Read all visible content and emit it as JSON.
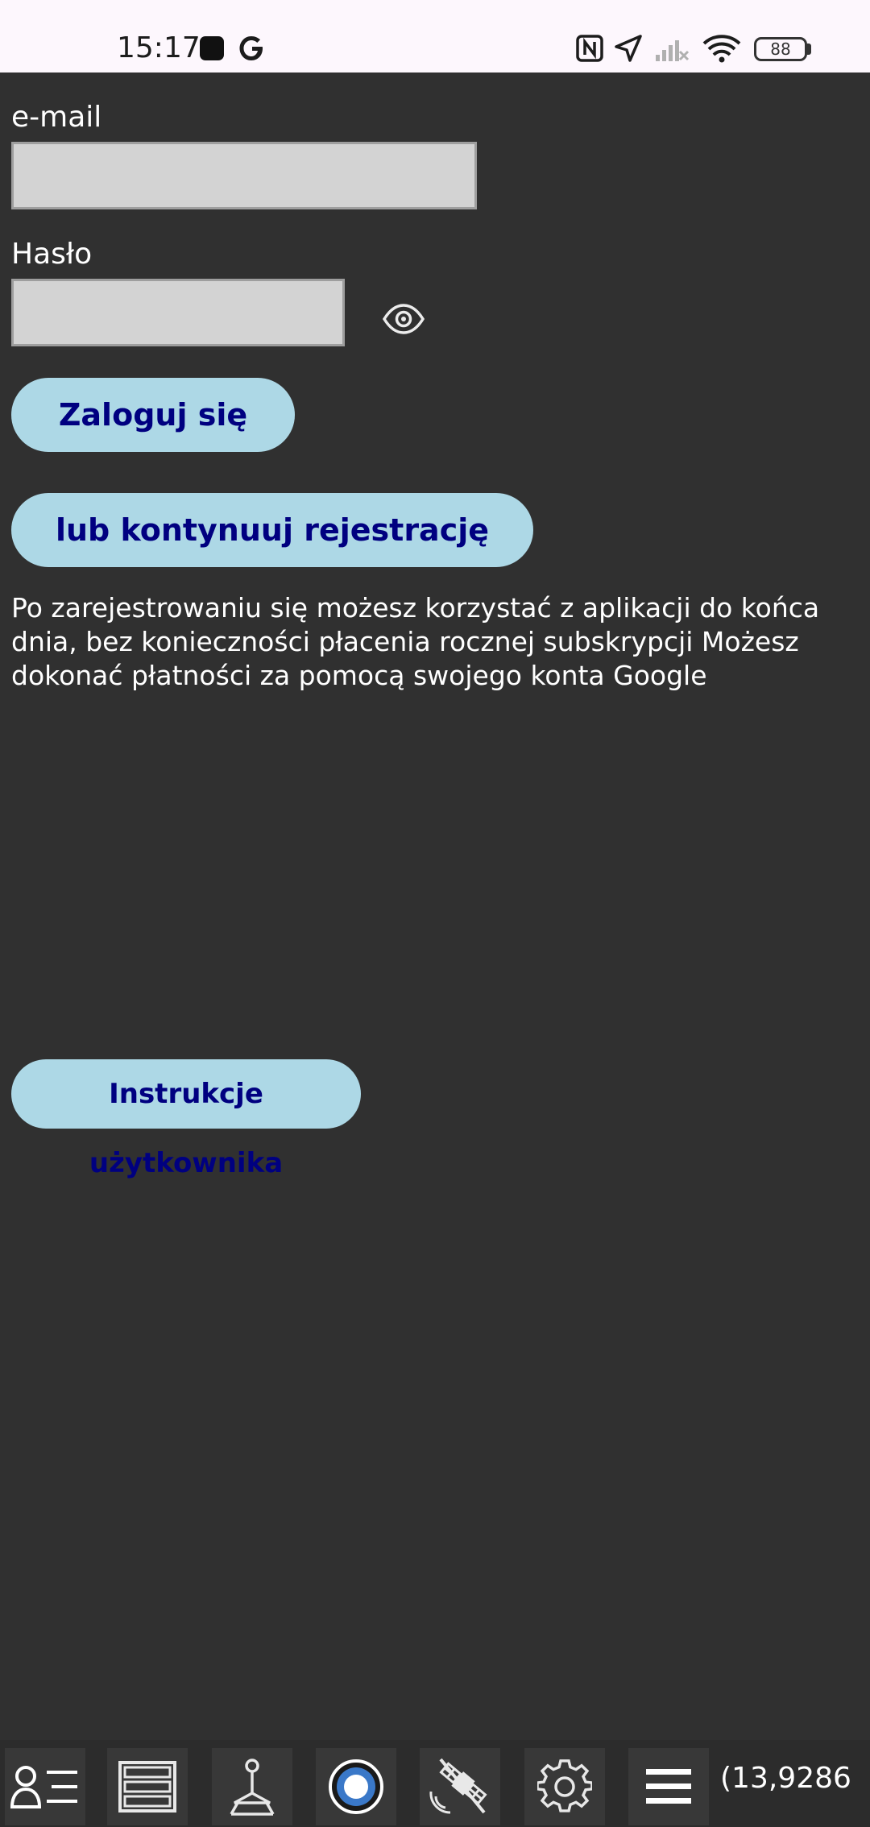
{
  "status_bar": {
    "time": "15:17",
    "battery": "88",
    "icons": [
      "square-notification-icon",
      "google-icon",
      "nfc-icon",
      "location-arrow-icon",
      "cell-signal-off-icon",
      "wifi-icon",
      "battery-icon"
    ]
  },
  "form": {
    "email_label": "e-mail",
    "email_value": "",
    "password_label": "Hasło",
    "password_value": "",
    "show_password_icon": "eye-icon"
  },
  "buttons": {
    "login": "Zaloguj się",
    "register": "lub kontynuuj rejestrację",
    "manual": "Instrukcje użytkownika"
  },
  "info_text": "Po zarejestrowaniu się możesz korzystać z aplikacji do końca dnia, bez konieczności płacenia rocznej subskrypcji Możesz dokonać płatności za pomocą swojego konta Google",
  "toolbar": {
    "items": [
      "user-list-icon",
      "list-view-icon",
      "survey-marker-icon",
      "record-icon",
      "satellite-icon",
      "gear-icon",
      "menu-icon"
    ],
    "coordinate": "(13,9286"
  },
  "colors": {
    "background": "#303030",
    "button_bg": "#add8e6",
    "button_text": "#000080",
    "input_bg": "#d3d3d3",
    "status_bar_bg": "#fdf7fd"
  }
}
